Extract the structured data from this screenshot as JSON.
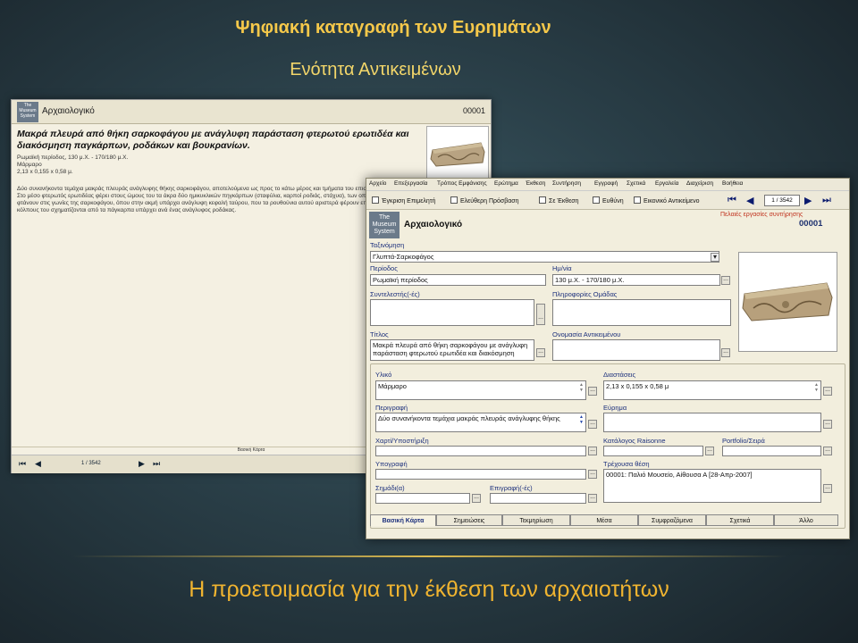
{
  "slide": {
    "title": "Ψηφιακή καταγραφή των Ευρημάτων",
    "subtitle": "Ενότητα Αντικειμένων",
    "footer": "Η προετοιμασία για την έκθεση των αρχαιοτήτων"
  },
  "back_window": {
    "logo": "The Museum System",
    "name": "Αρχαιολογικό",
    "code": "00001",
    "bold_title": "Μακρά πλευρά από θήκη σαρκοφάγου με ανάγλυφη παράσταση φτερωτού ερωτιδέα και διακόσμηση παγκάρπων, ροδάκων και βουκρανίων.",
    "period_line": "Ρωμαϊκή περίοδος, 130 μ.Χ. - 170/180 μ.Χ.",
    "material_line": "Μάρμαρο",
    "dims_line": "2,13 x 0,155 x 0,58 μ.",
    "desc_lines": [
      "Δύο συνανήκοντα τεμάχια μακράς πλευράς ανάγλυφης θήκης σαρκοφάγου, αποτελούμενα ως προς το κάτω μέρος και τμήματα του επισ",
      "Στο μέσο φτερωτός ερωτιδέας φέρει στους ώμους του τα άκρα δύο ημικυκλικών πηγκάρπων (σταφύλια, καρποί ροδιάς, στάχυα), των οπ",
      "φτάνουν στις γωνίες της σαρκοφάγου, όπου στην ακμή υπάρχει ανάγλυφη κεφαλή ταύρου, που τα ρουθούνια αυτού αριστερά φέρουν επι",
      "κόλπους του σχηματίζονται από τα πάγκαρπα υπάρχει ανά ένας ανάγλυφος ροδάκας."
    ],
    "status": "Βασική Κάρτα",
    "record_nav": "1 / 3542"
  },
  "front_window": {
    "menu": [
      "Αρχείο",
      "Επεξεργασία",
      "Τρόπος Εμφάνισης",
      "Ερώτημα",
      "Έκθεση",
      "Συντήρηση",
      "Εγγραφή",
      "Σχετικά",
      "Εργαλεία",
      "Διαχείριση",
      "Βοήθεια"
    ],
    "checkboxes": [
      "Έγκριση Επιμελητή",
      "Ελεύθερη Πρόσβαση",
      "Σε Έκθεση",
      "Ευθύνη",
      "Εικονικό Αντικείμενο"
    ],
    "record_nav": "1 / 3542",
    "logo": "The Museum System",
    "name": "Αρχαιολογικό",
    "conservation": "Πελαιές εργασίες συντήρησης",
    "code": "00001",
    "fields": {
      "classification_label": "Ταξινόμηση",
      "classification_value": "Γλυπτά-Σαρκοφάγος",
      "period_label": "Περίοδος",
      "period_value": "Ρωμαϊκή περίοδος",
      "date_label": "Ημ/νία",
      "date_value": "130 μ.Χ. - 170/180 μ.Χ.",
      "contributors_label": "Συντελεστής(-ές)",
      "group_info_label": "Πληροφορίες Ομάδας",
      "title_label": "Τίτλος",
      "title_value": "Μακρά πλευρά από θήκη σαρκοφάγου με ανάγλυφη παράσταση φτερωτού ερωτιδέα και διακόσμηση",
      "object_name_label": "Ονομασία Αντικειμένου",
      "material_label": "Υλικό",
      "material_value": "Μάρμαρο",
      "dimensions_label": "Διαστάσεις",
      "dimensions_value": "2,13 x 0,155 x 0,58 μ",
      "description_label": "Περιγραφή",
      "description_value": "Δύο συνανήκοντα τεμάχια μακράς πλευράς ανάγλυφης θήκης",
      "find_label": "Εύρημα",
      "paper_label": "Χαρτί/Υποστήριξη",
      "raisonne_label": "Κατάλογος Raisonne",
      "portfolio_label": "Portfolio/Σειρά",
      "signature_label": "Υπογραφή",
      "location_label": "Τρέχουσα θέση",
      "location_value": "00001: Παλιό Μουσείο, Αίθουσα Α [28-Απρ-2007]",
      "marks_label": "Σημάδι(α)",
      "inscription_label": "Επιγραφή(-ές)"
    },
    "tabs": [
      "Βασική Κάρτα",
      "Σημειώσεις",
      "Τεκμηρίωση",
      "Μέσα",
      "Συμφραζόμενα",
      "Σχετικά",
      "Άλλο"
    ]
  }
}
